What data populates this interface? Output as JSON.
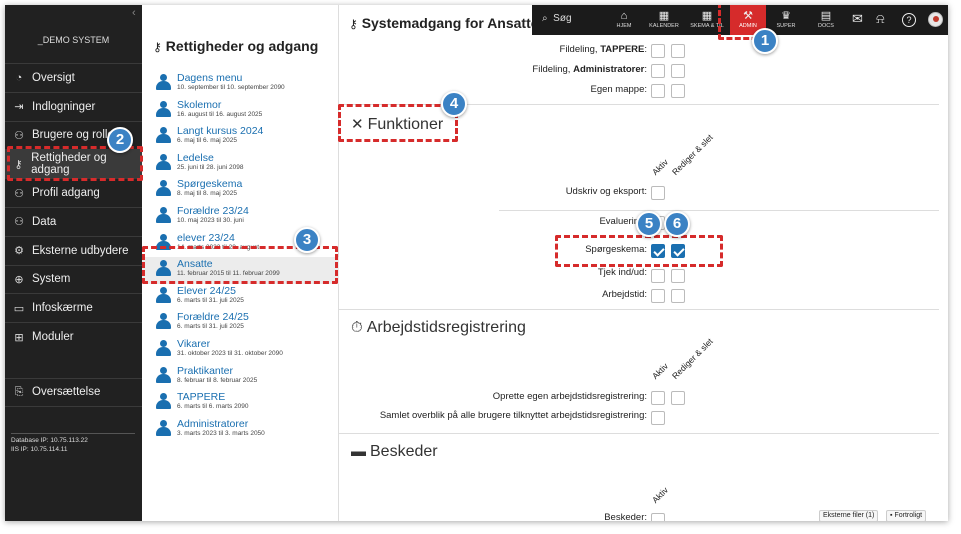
{
  "left_nav": {
    "system_name": "_DEMO SYSTEM",
    "items": [
      {
        "icon": "dashboard-icon",
        "glyph": "◔",
        "label": "Oversigt"
      },
      {
        "icon": "login-icon",
        "glyph": "⇥",
        "label": "Indlogninger"
      },
      {
        "icon": "users-icon",
        "glyph": "⚇",
        "label": "Brugere og roller"
      },
      {
        "icon": "key-icon",
        "glyph": "⚷",
        "label": "Rettigheder og adgang"
      },
      {
        "icon": "profile-icon",
        "glyph": "⚇",
        "label": "Profil adgang"
      },
      {
        "icon": "data-icon",
        "glyph": "⚇",
        "label": "Data"
      },
      {
        "icon": "external-icon",
        "glyph": "⚙",
        "label": "Eksterne udbydere"
      },
      {
        "icon": "globe-icon",
        "glyph": "⊕",
        "label": "System"
      },
      {
        "icon": "screen-icon",
        "glyph": "▭",
        "label": "Infoskærme"
      },
      {
        "icon": "modules-icon",
        "glyph": "⊞",
        "label": "Moduler"
      }
    ],
    "translate": {
      "icon": "translate-icon",
      "glyph": "⎘",
      "label": "Oversættelse"
    },
    "db_ip": "Database IP: 10.75.113.22",
    "iis_ip": "IIS IP: 10.75.114.11"
  },
  "middle": {
    "title": "Rettigheder og adgang",
    "groups": [
      {
        "name": "Dagens menu",
        "dates": "10. september til 10. september 2090"
      },
      {
        "name": "Skolemor",
        "dates": "16. august til 16. august 2025"
      },
      {
        "name": "Langt kursus 2024",
        "dates": "6. maj til 6. maj 2025"
      },
      {
        "name": "Ledelse",
        "dates": "25. juni til 28. juni 2098"
      },
      {
        "name": "Spørgeskema",
        "dates": "8. maj til 8. maj 2025"
      },
      {
        "name": "Forældre 23/24",
        "dates": "10. maj 2023 til 30. juni"
      },
      {
        "name": "elever 23/24",
        "dates": "14. marts 2023 til 28. august"
      },
      {
        "name": "Ansatte",
        "dates": "11. februar 2015 til 11. februar 2099"
      },
      {
        "name": "Elever 24/25",
        "dates": "6. marts til 31. juli 2025"
      },
      {
        "name": "Forældre 24/25",
        "dates": "6. marts til 31. juli 2025"
      },
      {
        "name": "Vikarer",
        "dates": "31. oktober 2023 til 31. oktober 2090"
      },
      {
        "name": "Praktikanter",
        "dates": "8. februar til 8. februar 2025"
      },
      {
        "name": "TAPPERE",
        "dates": "6. marts til 6. marts 2090"
      },
      {
        "name": "Administratorer",
        "dates": "3. marts 2023 til 3. marts 2050"
      }
    ],
    "selected_index": 7
  },
  "topbar": {
    "search_label": "Søg",
    "buttons": [
      {
        "icon": "home-icon",
        "glyph": "⌂",
        "label": "HJEM"
      },
      {
        "icon": "calendar-icon",
        "glyph": "▦",
        "label": "KALENDER"
      },
      {
        "icon": "schedule-icon",
        "glyph": "▦",
        "label": "SKEMA & TIL"
      },
      {
        "icon": "admin-icon",
        "glyph": "⚒",
        "label": "ADMIN",
        "active": true
      },
      {
        "icon": "crown-icon",
        "glyph": "♛",
        "label": "SUPER"
      },
      {
        "icon": "docs-icon",
        "glyph": "▤",
        "label": "DOCS"
      }
    ],
    "mail_icon": "✉",
    "bell_icon": "⍾",
    "help_icon": "?"
  },
  "content": {
    "page_title": "Systemadgang for Ansatte",
    "top_rows": [
      {
        "pre": "Fildeling, ",
        "bold": "TAPPERE",
        "post": ":"
      },
      {
        "pre": "Fildeling, ",
        "bold": "Administratorer",
        "post": ":"
      },
      {
        "pre": "Egen mappe:",
        "bold": "",
        "post": ""
      }
    ],
    "funktioner": {
      "title": "Funktioner",
      "col_aktiv": "Aktiv",
      "col_rediger": "Rediger & slet",
      "rows": [
        {
          "label": "Udskriv og eksport:",
          "aktiv": false,
          "rediger": null
        },
        {
          "label": "Evaluering:",
          "aktiv": false,
          "rediger": false
        },
        {
          "label": "Spørgeskema:",
          "aktiv": true,
          "rediger": true
        },
        {
          "label": "Tjek ind/ud:",
          "aktiv": false,
          "rediger": false
        },
        {
          "label": "Arbejdstid:",
          "aktiv": false,
          "rediger": false
        }
      ]
    },
    "arbejdstid": {
      "title": "Arbejdstidsregistrering",
      "col_aktiv": "Aktiv",
      "col_rediger": "Rediger & slet",
      "rows": [
        {
          "label": "Oprette egen arbejdstidsregistrering:"
        },
        {
          "label": "Samlet overblik på alle brugere tilknyttet arbejdstidsregistrering:"
        }
      ]
    },
    "beskeder": {
      "title": "Beskeder",
      "col_aktiv": "Aktiv",
      "rows": [
        {
          "label": "Beskeder:"
        }
      ]
    },
    "footer": {
      "files": "Eksterne filer (1)",
      "confidential": "Fortroligt"
    }
  },
  "annotations": [
    "1",
    "2",
    "3",
    "4",
    "5",
    "6"
  ]
}
